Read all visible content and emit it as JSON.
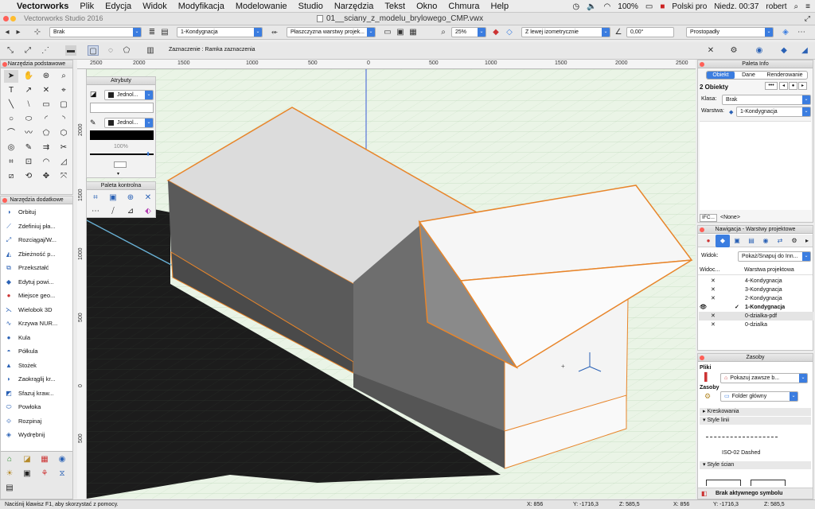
{
  "menubar": {
    "apple": "",
    "items": [
      "Vectorworks",
      "Plik",
      "Edycja",
      "Widok",
      "Modyfikacja",
      "Modelowanie",
      "Studio",
      "Narzędzia",
      "Tekst",
      "Okno",
      "Chmura",
      "Help"
    ],
    "battery": "100%",
    "input_source": "Polski pro",
    "clock": "Niedz. 00:37",
    "user": "robert"
  },
  "window": {
    "app_title": "Vectorworks Studio 2016",
    "doc_title": "01__sciany_z_modelu_brylowego_CMP.vwx"
  },
  "viewbar": {
    "class_value": "Brak",
    "layer_value": "1-Kondygnacja",
    "plane_value": "Płaszczyzna warstwy projek...",
    "zoom_value": "25%",
    "view_value": "Z lewej izometrycznie",
    "angle_value": "0,00°",
    "projection_value": "Prostopadły"
  },
  "toolbar2": {
    "mode_label": "Zaznaczenie : Ramka zaznaczenia"
  },
  "ruler_h": [
    "2500",
    "2000",
    "1500",
    "1000",
    "500",
    "0",
    "500",
    "1000",
    "1500",
    "2000",
    "2500"
  ],
  "ruler_v": [
    "2000",
    "1500",
    "1000",
    "500",
    "0",
    "500"
  ],
  "basic_tools": {
    "title": "Narzędzia podstawowe"
  },
  "extra_tools": {
    "title": "Narzędzia dodatkowe",
    "items": [
      "Orbituj",
      "Zdefiniuj pła...",
      "Rozciągaj/W...",
      "Zbieżność p...",
      "Przekształć",
      "Edytuj powi...",
      "Miejsce geo...",
      "Wielobok 3D",
      "Krzywa NUR...",
      "Kula",
      "Półkula",
      "Stożek",
      "Zaokrąglij kr...",
      "Sfazuj kraw...",
      "Powłoka",
      "Rozpinaj",
      "Wydrębnij"
    ]
  },
  "attributes": {
    "title": "Atrybuty",
    "fill_label": "Jednol...",
    "pen_label": "Jednol...",
    "opacity": "100%"
  },
  "control_palette": {
    "title": "Paleta kontrolna"
  },
  "info_palette": {
    "title": "Paleta Info",
    "tabs": [
      "Obiekt",
      "Dane",
      "Renderowanie"
    ],
    "selection": "2 Obiekty",
    "class_label": "Klasa:",
    "class_value": "Brak",
    "layer_label": "Warstwa:",
    "layer_value": "1-Kondygnacja",
    "ifc_label": "IFC...",
    "ifc_value": "<None>"
  },
  "navigation": {
    "title": "Nawigacja - Warstwy projektowe",
    "view_label": "Widok:",
    "view_value": "Pokaż/Snapuj do Inn...",
    "col_visibility": "Widoc...",
    "col_layer": "Warstwa projektowa",
    "layers": [
      {
        "name": "4-Kondygnacja",
        "vis": "✕",
        "active": false
      },
      {
        "name": "3-Kondygnacja",
        "vis": "✕",
        "active": false
      },
      {
        "name": "2-Kondygnacja",
        "vis": "✕",
        "active": false
      },
      {
        "name": "1-Kondygnacja",
        "vis": "👁",
        "active": true
      },
      {
        "name": "0-dzialka-pdf",
        "vis": "✕",
        "active": false
      },
      {
        "name": "0-dzialka",
        "vis": "✕",
        "active": false
      }
    ]
  },
  "resources": {
    "title": "Zasoby",
    "files_label": "Pliki",
    "files_value": "Pokazuj zawsze b...",
    "res_label": "Zasoby",
    "res_value": "Folder główny",
    "sections": [
      "Kreskowania",
      "Style linii",
      "Style ścian"
    ],
    "line_style_name": "ISO-02 Dashed",
    "status": "Brak aktywnego symbolu"
  },
  "statusbar": {
    "hint": "Naciśnij klawisz F1, aby skorzystać z pomocy.",
    "coords": [
      "X: 856",
      "Y: -1716,3",
      "Z: 585,5",
      "X: 856",
      "Y: -1716,3",
      "Z: 585,5"
    ]
  },
  "colors": {
    "selection": "#e8852a",
    "shadow": "#1c1c1c",
    "ground": "#eaf4e6",
    "accent": "#3b7de0"
  }
}
